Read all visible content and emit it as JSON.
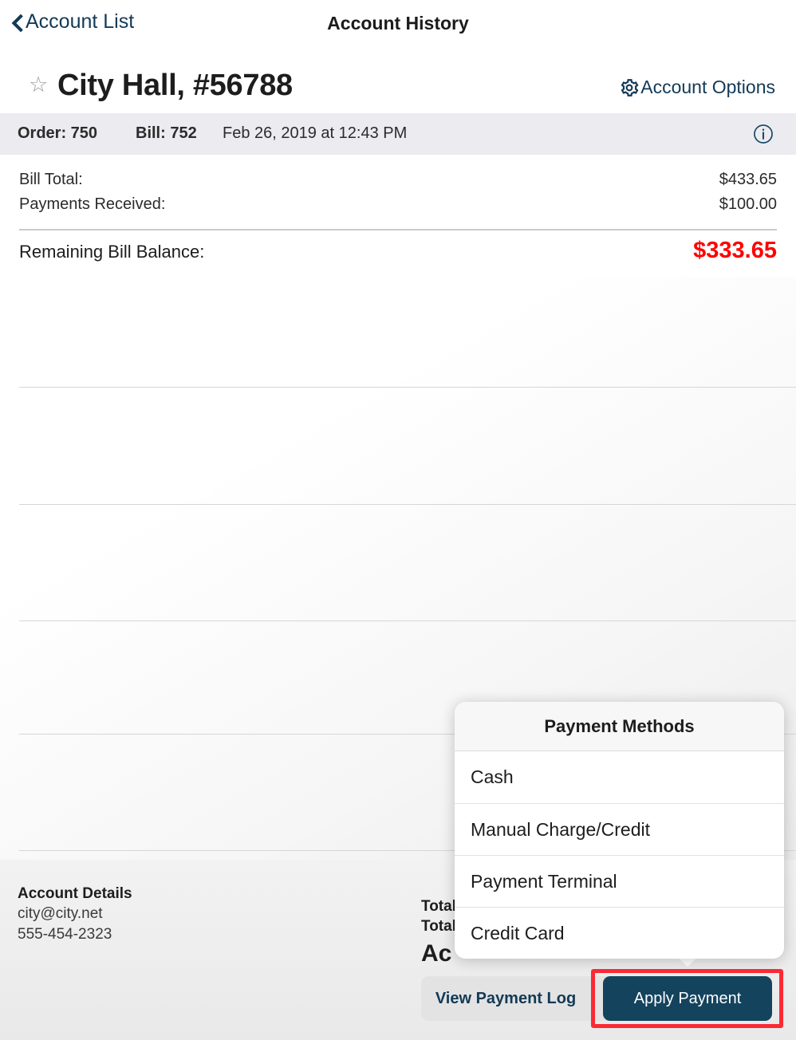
{
  "navbar": {
    "back_label": "Account List",
    "title": "Account History"
  },
  "account_header": {
    "star_glyph": "☆",
    "title": "City Hall, #56788",
    "options_label": "Account Options"
  },
  "order_bar": {
    "order": "Order: 750",
    "bill": "Bill: 752",
    "date": "Feb 26, 2019 at 12:43 PM"
  },
  "summary": {
    "rows": [
      {
        "label": "Bill Total:",
        "value": "$433.65"
      },
      {
        "label": "Payments Received:",
        "value": "$100.00"
      }
    ],
    "total_label": "Remaining Bill Balance:",
    "total_value": "$333.65"
  },
  "footer": {
    "account_details_title": "Account Details",
    "email": "city@city.net",
    "phone": "555-454-2323",
    "totals": {
      "line1": "Total",
      "line2": "Total",
      "big": "Ac"
    },
    "view_log_label": "View Payment Log",
    "apply_payment_label": "Apply Payment"
  },
  "popover": {
    "title": "Payment Methods",
    "items": [
      {
        "label": "Cash"
      },
      {
        "label": "Manual Charge/Credit"
      },
      {
        "label": "Payment Terminal"
      },
      {
        "label": "Credit Card"
      }
    ]
  },
  "colors": {
    "accent_navy": "#14435d",
    "link_navy": "#123a56",
    "balance_red": "#ff0000",
    "highlight_red": "#fb2a35",
    "order_bar_bg": "#ebebf0"
  }
}
